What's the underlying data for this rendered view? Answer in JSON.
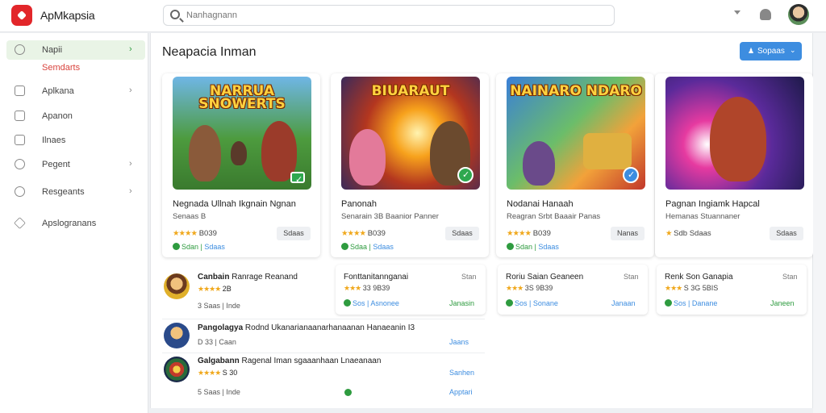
{
  "app": {
    "title": "ApMkapsia"
  },
  "search": {
    "placeholder": "Nanhagnann"
  },
  "sidebar": {
    "items": [
      {
        "label": "Napii",
        "icon": "circle-icon",
        "active": true
      },
      {
        "label": "Semdarts",
        "icon": "none",
        "accent": "red"
      },
      {
        "label": "Aplkana",
        "icon": "grid-icon"
      },
      {
        "label": "Apanon",
        "icon": "box-icon"
      },
      {
        "label": "Ilnaes",
        "icon": "doc-icon"
      },
      {
        "label": "Pegent",
        "icon": "circle-icon"
      },
      {
        "label": "Resgeants",
        "icon": "globe-icon"
      },
      {
        "label": "Apslogranans",
        "icon": "star-icon"
      }
    ]
  },
  "main": {
    "title": "Neapacia Inman",
    "action_button": "Sopaas",
    "featured": [
      {
        "art_title": "NARRUA SNOWERTS",
        "title": "Negnada Ullnah Ikgnain Ngnan",
        "subtitle": "Senaas B",
        "stars": "★★★★",
        "rating": "B039",
        "tag": "Sdaas",
        "foot_a": "Sdan",
        "foot_b": "Sdaas"
      },
      {
        "art_title": "BIUARAUT",
        "title": "Panonah",
        "subtitle": "Senarain 3B Baanior Panner",
        "stars": "★★★★",
        "rating": "B039",
        "tag": "Sdaas",
        "foot_a": "Sdaa",
        "foot_b": "Sdaas"
      },
      {
        "art_title": "NAINARO NDARO",
        "title": "Nodanai Hanaah",
        "subtitle": "Reagran Srbt Baaair Panas",
        "stars": "★★★★",
        "rating": "B039",
        "tag": "Nanas",
        "foot_a": "Sdan",
        "foot_b": "Sdaas"
      },
      {
        "art_title": "",
        "title": "Pagnan Ingiamk Hapcal",
        "subtitle": "Hemanas Stuannaner",
        "stars": "★",
        "rating": "Sdb Sdaas",
        "tag": "Sdaas",
        "foot_a": "",
        "foot_b": ""
      }
    ],
    "list": [
      {
        "title": "Canbain",
        "extra": "Ranrage Reanand",
        "stars": "★★★★",
        "rating": "2B",
        "foot": "3 Saas | Inde"
      },
      {
        "title": "Pangolagya",
        "extra": "Rodnd Ukanarianaanarhanaanan Hanaeanin I3",
        "stars": "",
        "rating": "",
        "foot": "D 33 | Caan",
        "link": "Jaans"
      },
      {
        "title": "Galgabann",
        "extra": "Ragenal Iman sgaaanhaan Lnaeanaan",
        "stars": "★★★★",
        "rating": "S 30",
        "foot": "5 Saas | Inde",
        "link": "Sanhen",
        "link2": "Apptari"
      }
    ],
    "mini_cards": [
      {
        "title": "Fonttanitannganai",
        "status": "Stan",
        "stars": "★★★",
        "rating": "33 9B39",
        "foot_a": "Sos",
        "foot_b": "Asnonee",
        "link": "Janasin"
      },
      {
        "title": "Roriu Saian Geaneen",
        "status": "Stan",
        "stars": "★★★",
        "rating": "3S 9B39",
        "foot_a": "Sos",
        "foot_b": "Sonane",
        "link": "Janaan"
      },
      {
        "title": "Renk Son Ganapia",
        "status": "Stan",
        "stars": "★★★",
        "rating": "S 3G 5BIS",
        "foot_a": "Sos",
        "foot_b": "Danane",
        "link": "Janeen"
      }
    ]
  },
  "colors": {
    "accent": "#3d8de0",
    "brand": "#e2262a",
    "success": "#2e9b3f",
    "star": "#f0a81c"
  }
}
